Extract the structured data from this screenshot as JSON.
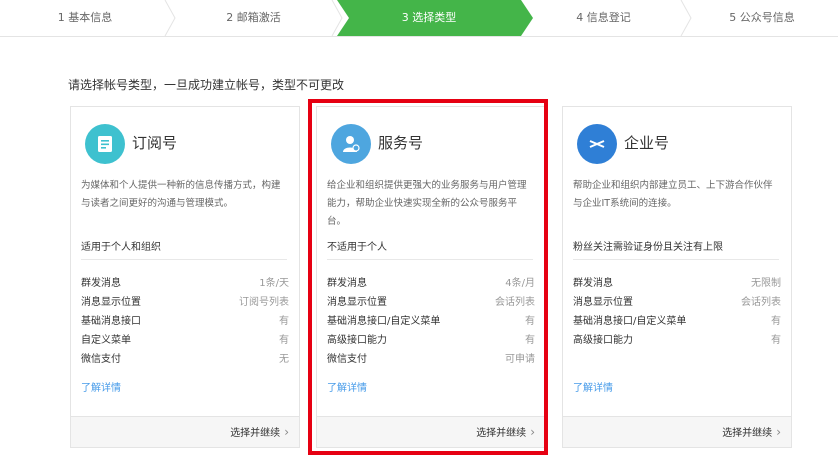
{
  "steps": [
    {
      "label": "1 基本信息"
    },
    {
      "label": "2 邮箱激活"
    },
    {
      "label": "3 选择类型"
    },
    {
      "label": "4 信息登记"
    },
    {
      "label": "5 公众号信息"
    }
  ],
  "active_step_color": "#44b549",
  "intro": "请选择帐号类型，一旦成功建立帐号，类型不可更改",
  "cards": [
    {
      "icon": "subscription-doc-icon",
      "title": "订阅号",
      "desc": "为媒体和个人提供一种新的信息传播方式，构建与读者之间更好的沟通与管理模式。",
      "scope": "适用于个人和组织",
      "features": [
        {
          "k": "群发消息",
          "v": "1条/天"
        },
        {
          "k": "消息显示位置",
          "v": "订阅号列表"
        },
        {
          "k": "基础消息接口",
          "v": "有"
        },
        {
          "k": "自定义菜单",
          "v": "有"
        },
        {
          "k": "微信支付",
          "v": "无"
        }
      ],
      "more": "了解详情",
      "action": "选择并继续"
    },
    {
      "icon": "service-person-icon",
      "title": "服务号",
      "desc": "给企业和组织提供更强大的业务服务与用户管理能力，帮助企业快速实现全新的公众号服务平台。",
      "scope": "不适用于个人",
      "features": [
        {
          "k": "群发消息",
          "v": "4条/月"
        },
        {
          "k": "消息显示位置",
          "v": "会话列表"
        },
        {
          "k": "基础消息接口/自定义菜单",
          "v": "有"
        },
        {
          "k": "高级接口能力",
          "v": "有"
        },
        {
          "k": "微信支付",
          "v": "可申请"
        }
      ],
      "more": "了解详情",
      "action": "选择并继续"
    },
    {
      "icon": "enterprise-link-icon",
      "title": "企业号",
      "desc": "帮助企业和组织内部建立员工、上下游合作伙伴与企业IT系统间的连接。",
      "scope": "粉丝关注需验证身份且关注有上限",
      "features": [
        {
          "k": "群发消息",
          "v": "无限制"
        },
        {
          "k": "消息显示位置",
          "v": "会话列表"
        },
        {
          "k": "基础消息接口/自定义菜单",
          "v": "有"
        },
        {
          "k": "高级接口能力",
          "v": "有"
        }
      ],
      "more": "了解详情",
      "action": "选择并继续"
    }
  ],
  "highlight_color": "#e60012",
  "link_color": "#459ae9"
}
